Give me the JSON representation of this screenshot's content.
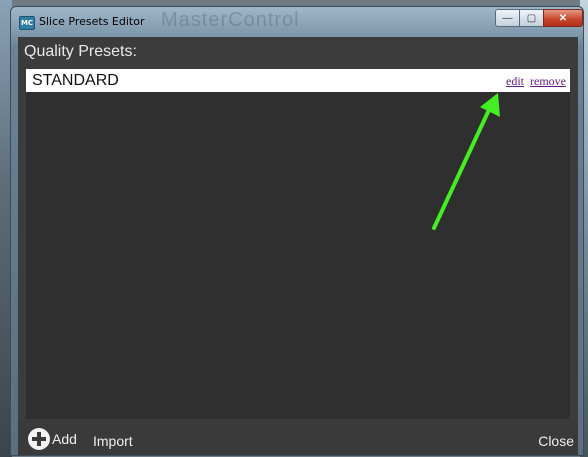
{
  "window": {
    "title": "Slice Presets Editor",
    "background_text": "MasterControl"
  },
  "controls": {
    "minimize": "—",
    "maximize": "▢",
    "close": "✕"
  },
  "section": {
    "heading": "Quality Presets:"
  },
  "presets": [
    {
      "name": "STANDARD",
      "edit_label": "edit",
      "remove_label": "remove"
    }
  ],
  "footer": {
    "add_label": "Add",
    "import_label": "Import",
    "close_label": "Close"
  },
  "colors": {
    "annotation_arrow": "#44ee22",
    "link": "#6a1b8a",
    "client_bg": "#3c3c3c"
  }
}
